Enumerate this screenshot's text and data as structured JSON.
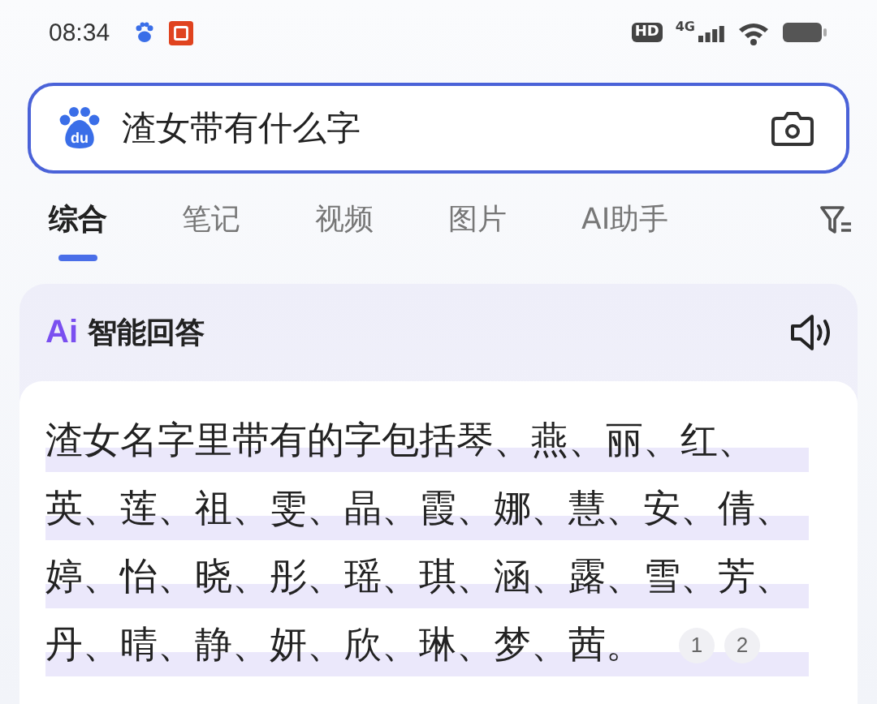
{
  "status_bar": {
    "time": "08:34",
    "network": "4G",
    "hd": "HD"
  },
  "search": {
    "logo_text": "du",
    "value": "渣女带有什么字"
  },
  "tabs": [
    {
      "label": "综合",
      "selected": true
    },
    {
      "label": "笔记",
      "selected": false
    },
    {
      "label": "视频",
      "selected": false
    },
    {
      "label": "图片",
      "selected": false
    },
    {
      "label": "AI助手",
      "selected": false
    }
  ],
  "ai_answer": {
    "logo": "Ai",
    "title": "智能回答",
    "text": "渣女名字里带有的字包括琴、燕、丽、红、英、莲、祖、雯、晶、霞、娜、慧、安、倩、婷、怡、晓、彤、瑶、琪、涵、露、雪、芳、丹、晴、静、妍、欣、琳、梦、茜。",
    "citations": [
      "1",
      "2"
    ]
  }
}
